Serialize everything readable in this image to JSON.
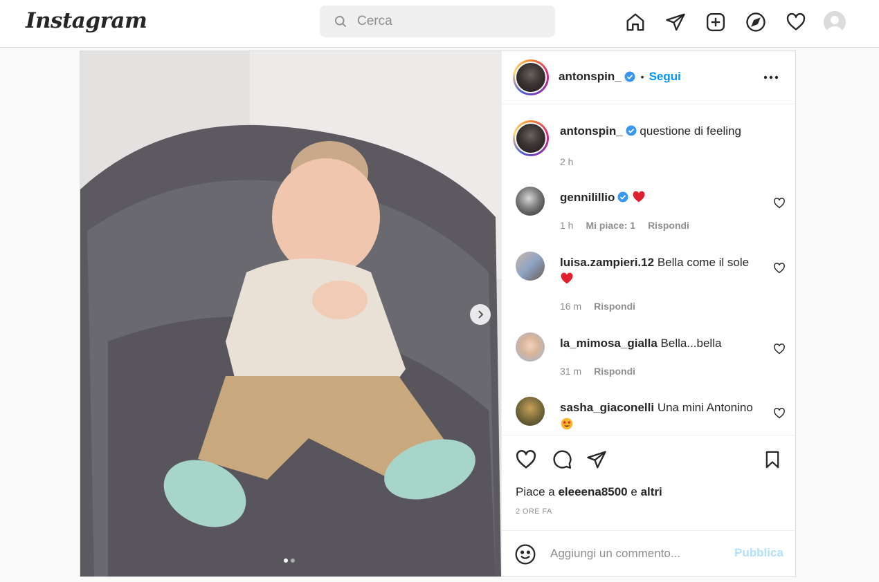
{
  "nav": {
    "logo": "Instagram",
    "search_placeholder": "Cerca",
    "icons": [
      "home-icon",
      "direct-send-icon",
      "new-post-icon",
      "explore-icon",
      "activity-heart-icon",
      "profile-avatar"
    ]
  },
  "post": {
    "author": "antonspin_",
    "follow_label": "Segui",
    "separator": "•",
    "carousel": {
      "current": 1,
      "total": 2
    },
    "caption": {
      "user": "antonspin_",
      "text": "questione di feeling",
      "time": "2 h"
    },
    "comments": [
      {
        "user": "gennilillio",
        "verified": true,
        "text": "",
        "emoji": "red-heart",
        "time": "1 h",
        "likes": "Mi piace: 1",
        "reply": "Rispondi"
      },
      {
        "user": "luisa.zampieri.12",
        "verified": false,
        "text": "Bella come il sole",
        "emoji": "red-heart",
        "time": "16 m",
        "likes": "",
        "reply": "Rispondi"
      },
      {
        "user": "la_mimosa_gialla",
        "verified": false,
        "text": "Bella...bella",
        "emoji": "",
        "time": "31 m",
        "likes": "",
        "reply": "Rispondi"
      },
      {
        "user": "sasha_giaconelli",
        "verified": false,
        "text": "Una mini Antonino",
        "emoji": "star-struck",
        "time": "",
        "likes": "",
        "reply": ""
      }
    ],
    "likes_prefix": "Piace a",
    "likes_user": "eleeena8500",
    "likes_joiner": "e",
    "likes_suffix": "altri",
    "timestamp": "2 ORE FA",
    "comment_placeholder": "Aggiungi un commento...",
    "publish_label": "Pubblica"
  },
  "colors": {
    "accent": "#0095f6",
    "publish_disabled": "#b2dffc",
    "heart": "#ed4956",
    "verified": "#3897f0"
  }
}
